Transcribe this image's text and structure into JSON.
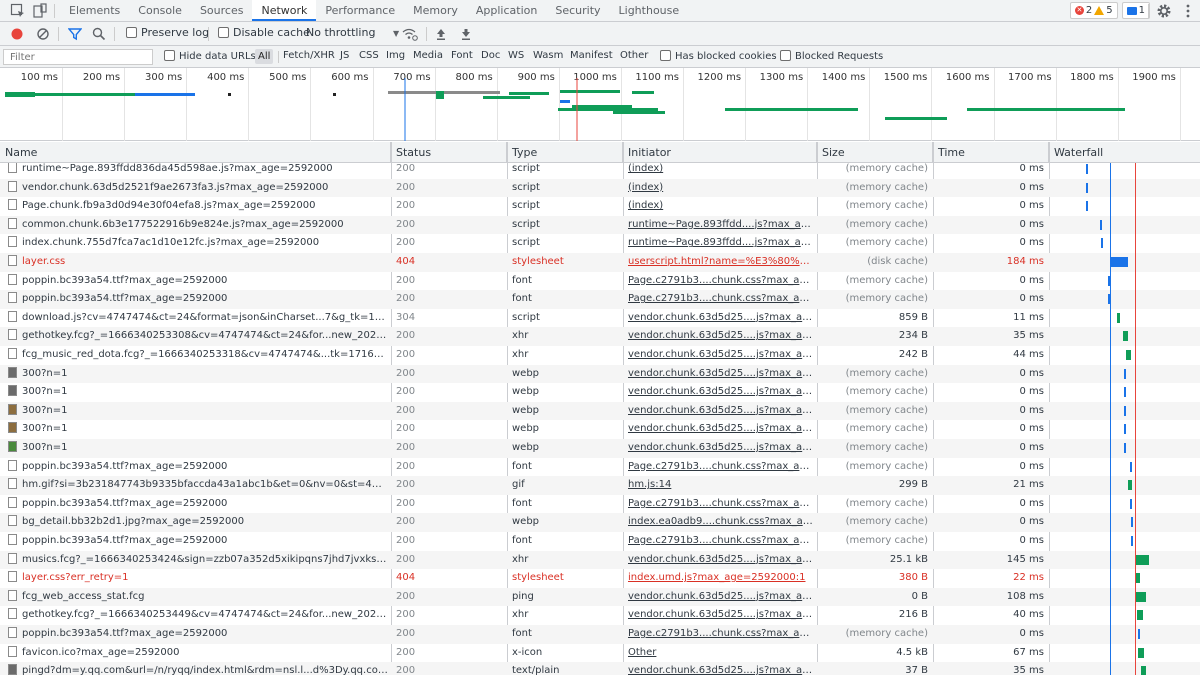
{
  "tabbar": {
    "tabs": [
      "Elements",
      "Console",
      "Sources",
      "Network",
      "Performance",
      "Memory",
      "Application",
      "Security",
      "Lighthouse"
    ],
    "active_tab": "Network",
    "errors_count": "2",
    "warnings_count": "5",
    "messages_count": "1"
  },
  "toolbar": {
    "preserve_log": "Preserve log",
    "disable_cache": "Disable cache",
    "throttling": "No throttling"
  },
  "filterbar": {
    "filter_placeholder": "Filter",
    "hide_data_urls": "Hide data URLs",
    "types": [
      "All",
      "Fetch/XHR",
      "JS",
      "CSS",
      "Img",
      "Media",
      "Font",
      "Doc",
      "WS",
      "Wasm",
      "Manifest",
      "Other"
    ],
    "has_blocked_cookies": "Has blocked cookies",
    "blocked_requests": "Blocked Requests"
  },
  "overview": {
    "ticks": [
      "100 ms",
      "200 ms",
      "300 ms",
      "400 ms",
      "500 ms",
      "600 ms",
      "700 ms",
      "800 ms",
      "900 ms",
      "1000 ms",
      "1100 ms",
      "1200 ms",
      "1300 ms",
      "1400 ms",
      "1500 ms",
      "1600 ms",
      "1700 ms",
      "1800 ms",
      "1900 ms"
    ]
  },
  "table": {
    "columns": [
      "Name",
      "Status",
      "Type",
      "Initiator",
      "Size",
      "Time",
      "Waterfall"
    ],
    "rows": [
      {
        "name": "runtime~Page.893ffdd836da45d598ae.js?max_age=2592000",
        "status": "200",
        "type": "script",
        "initiator": "(index)",
        "size": "(memory cache)",
        "time": "0 ms",
        "icon": "file",
        "error": false
      },
      {
        "name": "vendor.chunk.63d5d2521f9ae2673fa3.js?max_age=2592000",
        "status": "200",
        "type": "script",
        "initiator": "(index)",
        "size": "(memory cache)",
        "time": "0 ms",
        "icon": "file",
        "error": false
      },
      {
        "name": "Page.chunk.fb9a3d0d94e30f04efa8.js?max_age=2592000",
        "status": "200",
        "type": "script",
        "initiator": "(index)",
        "size": "(memory cache)",
        "time": "0 ms",
        "icon": "file",
        "error": false
      },
      {
        "name": "common.chunk.6b3e177522916b9e824e.js?max_age=2592000",
        "status": "200",
        "type": "script",
        "initiator": "runtime~Page.893ffdd....js?max_age=...",
        "size": "(memory cache)",
        "time": "0 ms",
        "icon": "file",
        "error": false
      },
      {
        "name": "index.chunk.755d7fca7ac1d10e12fc.js?max_age=2592000",
        "status": "200",
        "type": "script",
        "initiator": "runtime~Page.893ffdd....js?max_age=...",
        "size": "(memory cache)",
        "time": "0 ms",
        "icon": "file",
        "error": false
      },
      {
        "name": "layer.css",
        "status": "404",
        "type": "stylesheet",
        "initiator": "userscript.html?name=%E3%80%90%...",
        "size": "(disk cache)",
        "time": "184 ms",
        "icon": "file",
        "error": true
      },
      {
        "name": "poppin.bc393a54.ttf?max_age=2592000",
        "status": "200",
        "type": "font",
        "initiator": "Page.c2791b3....chunk.css?max_age=2...",
        "size": "(memory cache)",
        "time": "0 ms",
        "icon": "file",
        "error": false
      },
      {
        "name": "poppin.bc393a54.ttf?max_age=2592000",
        "status": "200",
        "type": "font",
        "initiator": "Page.c2791b3....chunk.css?max_age=2...",
        "size": "(memory cache)",
        "time": "0 ms",
        "icon": "file",
        "error": false
      },
      {
        "name": "download.js?cv=4747474&ct=24&format=json&inCharset...7&g_tk=17167...",
        "status": "304",
        "type": "script",
        "initiator": "vendor.chunk.63d5d25....js?max_age=...",
        "size": "859 B",
        "time": "11 ms",
        "icon": "file",
        "error": false
      },
      {
        "name": "gethotkey.fcg?_=1666340253308&cv=4747474&ct=24&for...new_2020030...",
        "status": "200",
        "type": "xhr",
        "initiator": "vendor.chunk.63d5d25....js?max_age=...",
        "size": "234 B",
        "time": "35 ms",
        "icon": "file",
        "error": false
      },
      {
        "name": "fcg_music_red_dota.fcg?_=1666340253318&cv=4747474&...tk=1716710187...",
        "status": "200",
        "type": "xhr",
        "initiator": "vendor.chunk.63d5d25....js?max_age=...",
        "size": "242 B",
        "time": "44 ms",
        "icon": "file",
        "error": false
      },
      {
        "name": "300?n=1",
        "status": "200",
        "type": "webp",
        "initiator": "vendor.chunk.63d5d25....js?max_age=...",
        "size": "(memory cache)",
        "time": "0 ms",
        "icon": "img",
        "error": false
      },
      {
        "name": "300?n=1",
        "status": "200",
        "type": "webp",
        "initiator": "vendor.chunk.63d5d25....js?max_age=...",
        "size": "(memory cache)",
        "time": "0 ms",
        "icon": "img",
        "error": false
      },
      {
        "name": "300?n=1",
        "status": "200",
        "type": "webp",
        "initiator": "vendor.chunk.63d5d25....js?max_age=...",
        "size": "(memory cache)",
        "time": "0 ms",
        "icon": "img2",
        "error": false
      },
      {
        "name": "300?n=1",
        "status": "200",
        "type": "webp",
        "initiator": "vendor.chunk.63d5d25....js?max_age=...",
        "size": "(memory cache)",
        "time": "0 ms",
        "icon": "img2",
        "error": false
      },
      {
        "name": "300?n=1",
        "status": "200",
        "type": "webp",
        "initiator": "vendor.chunk.63d5d25....js?max_age=...",
        "size": "(memory cache)",
        "time": "0 ms",
        "icon": "img3",
        "error": false
      },
      {
        "name": "poppin.bc393a54.ttf?max_age=2592000",
        "status": "200",
        "type": "font",
        "initiator": "Page.c2791b3....chunk.css?max_age=2...",
        "size": "(memory cache)",
        "time": "0 ms",
        "icon": "file",
        "error": false
      },
      {
        "name": "hm.gif?si=3b231847743b9335bfaccda43a1abc1b&et=0&nv=0&st=4&v=pi...",
        "status": "200",
        "type": "gif",
        "initiator": "hm.js:14",
        "size": "299 B",
        "time": "21 ms",
        "icon": "file",
        "error": false
      },
      {
        "name": "poppin.bc393a54.ttf?max_age=2592000",
        "status": "200",
        "type": "font",
        "initiator": "Page.c2791b3....chunk.css?max_age=2...",
        "size": "(memory cache)",
        "time": "0 ms",
        "icon": "file",
        "error": false
      },
      {
        "name": "bg_detail.bb32b2d1.jpg?max_age=2592000",
        "status": "200",
        "type": "webp",
        "initiator": "index.ea0adb9....chunk.css?max_age=...",
        "size": "(memory cache)",
        "time": "0 ms",
        "icon": "file",
        "error": false
      },
      {
        "name": "poppin.bc393a54.ttf?max_age=2592000",
        "status": "200",
        "type": "font",
        "initiator": "Page.c2791b3....chunk.css?max_age=2...",
        "size": "(memory cache)",
        "time": "0 ms",
        "icon": "file",
        "error": false
      },
      {
        "name": "musics.fcg?_=1666340253424&sign=zzb07a352d5xikipqns7jhd7jvxkswq214...",
        "status": "200",
        "type": "xhr",
        "initiator": "vendor.chunk.63d5d25....js?max_age=...",
        "size": "25.1 kB",
        "time": "145 ms",
        "icon": "file",
        "error": false
      },
      {
        "name": "layer.css?err_retry=1",
        "status": "404",
        "type": "stylesheet",
        "initiator": "index.umd.js?max_age=2592000:1",
        "size": "380 B",
        "time": "22 ms",
        "icon": "file",
        "error": true
      },
      {
        "name": "fcg_web_access_stat.fcg",
        "status": "200",
        "type": "ping",
        "initiator": "vendor.chunk.63d5d25....js?max_age=...",
        "size": "0 B",
        "time": "108 ms",
        "icon": "file",
        "error": false
      },
      {
        "name": "gethotkey.fcg?_=1666340253449&cv=4747474&ct=24&for...new_2020030...",
        "status": "200",
        "type": "xhr",
        "initiator": "vendor.chunk.63d5d25....js?max_age=...",
        "size": "216 B",
        "time": "40 ms",
        "icon": "file",
        "error": false
      },
      {
        "name": "poppin.bc393a54.ttf?max_age=2592000",
        "status": "200",
        "type": "font",
        "initiator": "Page.c2791b3....chunk.css?max_age=2...",
        "size": "(memory cache)",
        "time": "0 ms",
        "icon": "file",
        "error": false
      },
      {
        "name": "favicon.ico?max_age=2592000",
        "status": "200",
        "type": "x-icon",
        "initiator": "Other",
        "size": "4.5 kB",
        "time": "67 ms",
        "icon": "file",
        "error": false
      },
      {
        "name": "pingd?dm=y.qq.com&url=/n/ryqq/index.html&rdm=nsl.l...d%3Dy.qq.com%...",
        "status": "200",
        "type": "text/plain",
        "initiator": "vendor.chunk.63d5d25....js?max_age=...",
        "size": "37 B",
        "time": "35 ms",
        "icon": "img",
        "error": false
      }
    ]
  },
  "colors": {
    "accent": "#1a73e8",
    "error": "#d93025",
    "waterfall_green": "#0f9d58",
    "waterfall_blue": "#1a73e8",
    "load_line": "#e8453c"
  }
}
